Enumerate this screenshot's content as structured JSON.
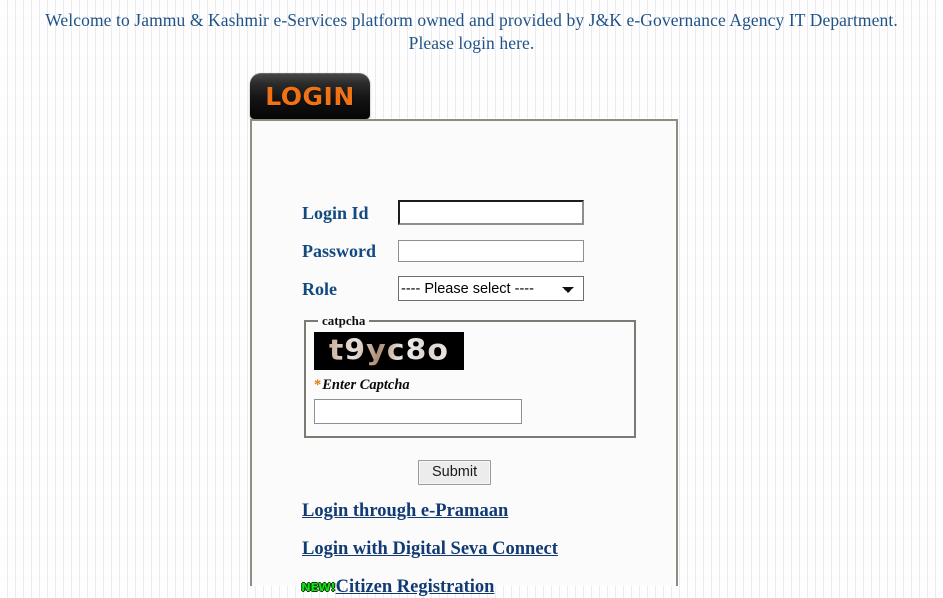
{
  "header": {
    "line1": "Welcome to Jammu & Kashmir e-Services platform owned and provided by J&K e-Governance Agency IT Department.",
    "line2": "Please login here.",
    "text_color": "#1f5286"
  },
  "tab": {
    "label": "LOGIN",
    "text_color": "#ef7215",
    "background_color": "#141414"
  },
  "form": {
    "login_id": {
      "label": "Login Id",
      "value": "",
      "placeholder": ""
    },
    "password": {
      "label": "Password",
      "value": "",
      "placeholder": ""
    },
    "role": {
      "label": "Role",
      "selected": "---- Please select ----",
      "options": [
        "---- Please select ----"
      ]
    },
    "label_color": "#12497f"
  },
  "captcha": {
    "legend": "catpcha",
    "image_text": "t9yc8o",
    "enter_label": "Enter Captcha",
    "required_marker": "*",
    "required_marker_color": "#e07a10",
    "input_value": "",
    "input_placeholder": ""
  },
  "actions": {
    "submit_label": "Submit"
  },
  "links": [
    {
      "label": "Login through e-Pramaan",
      "badge": null
    },
    {
      "label": "Login with Digital Seva Connect",
      "badge": null
    },
    {
      "label": "Citizen Registration",
      "badge": "NEW!"
    }
  ]
}
